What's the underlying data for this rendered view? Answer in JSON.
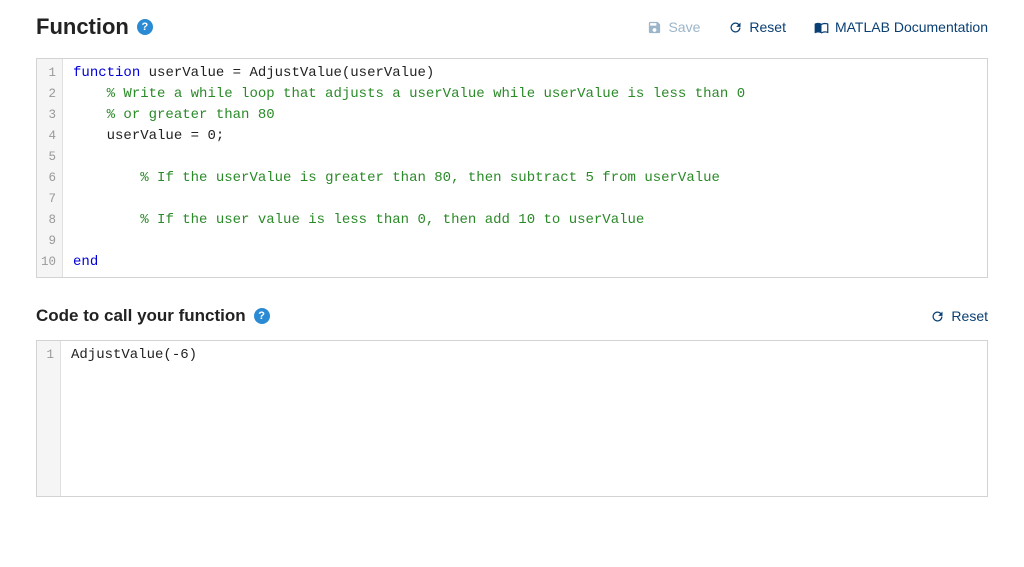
{
  "section1": {
    "title": "Function",
    "actions": {
      "save": "Save",
      "reset": "Reset",
      "docs": "MATLAB Documentation"
    },
    "lines": [
      {
        "n": "1",
        "seg": [
          {
            "c": "kw",
            "t": "function"
          },
          {
            "c": "txt",
            "t": " userValue = AdjustValue(userValue)"
          }
        ]
      },
      {
        "n": "2",
        "seg": [
          {
            "c": "txt",
            "t": "    "
          },
          {
            "c": "cmt",
            "t": "% Write a while loop that adjusts a userValue while userValue is less than 0"
          }
        ]
      },
      {
        "n": "3",
        "seg": [
          {
            "c": "txt",
            "t": "    "
          },
          {
            "c": "cmt",
            "t": "% or greater than 80"
          }
        ]
      },
      {
        "n": "4",
        "seg": [
          {
            "c": "txt",
            "t": "    userValue = 0;"
          }
        ]
      },
      {
        "n": "5",
        "seg": []
      },
      {
        "n": "6",
        "seg": [
          {
            "c": "txt",
            "t": "        "
          },
          {
            "c": "cmt",
            "t": "% If the userValue is greater than 80, then subtract 5 from userValue"
          }
        ]
      },
      {
        "n": "7",
        "seg": []
      },
      {
        "n": "8",
        "seg": [
          {
            "c": "txt",
            "t": "        "
          },
          {
            "c": "cmt",
            "t": "% If the user value is less than 0, then add 10 to userValue"
          }
        ]
      },
      {
        "n": "9",
        "seg": []
      },
      {
        "n": "10",
        "seg": [
          {
            "c": "kw",
            "t": "end"
          }
        ]
      }
    ]
  },
  "section2": {
    "title": "Code to call your function",
    "actions": {
      "reset": "Reset"
    },
    "lines": [
      {
        "n": "1",
        "seg": [
          {
            "c": "txt",
            "t": "AdjustValue(-6)"
          }
        ]
      }
    ]
  }
}
